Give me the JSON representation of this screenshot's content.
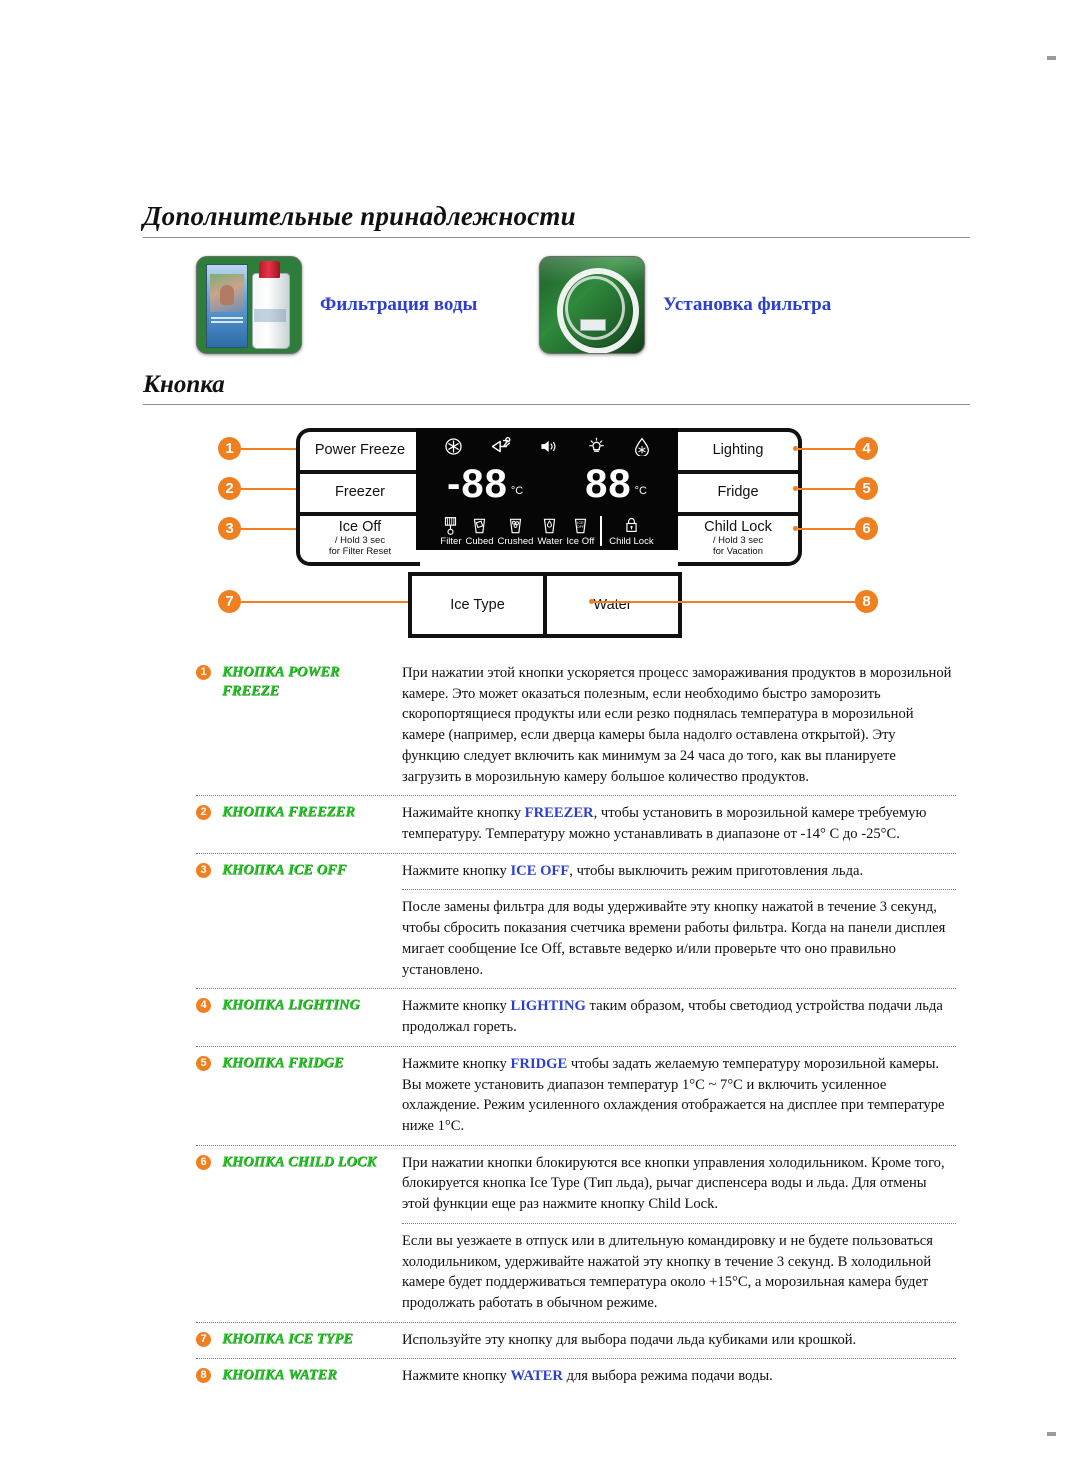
{
  "document": {
    "section_title": "Дополнительные принадлежности",
    "subsection_title": "Кнопка"
  },
  "accessories": [
    {
      "label": "Фильтрация воды",
      "image": "water-filter-box-photo"
    },
    {
      "label": "Установка фильтра",
      "image": "filter-tubing-coil-photo"
    }
  ],
  "panel": {
    "left_buttons": [
      {
        "badge": "1",
        "main": "Power Freeze",
        "sub1": "",
        "sub2": ""
      },
      {
        "badge": "2",
        "main": "Freezer",
        "sub1": "",
        "sub2": ""
      },
      {
        "badge": "3",
        "main": "Ice Off",
        "sub1": "/ Hold 3 sec",
        "sub2": "for Filter Reset"
      }
    ],
    "right_buttons": [
      {
        "badge": "4",
        "main": "Lighting",
        "sub1": "",
        "sub2": ""
      },
      {
        "badge": "5",
        "main": "Fridge",
        "sub1": "",
        "sub2": ""
      },
      {
        "badge": "6",
        "main": "Child Lock",
        "sub1": "/ Hold 3 sec",
        "sub2": "for Vacation"
      }
    ],
    "bottom_buttons": [
      {
        "badge": "7",
        "label": "Ice Type"
      },
      {
        "badge": "8",
        "label": "Water"
      }
    ],
    "lcd": {
      "top_icons": [
        "snowflake-icon",
        "power-freeze-icon",
        "speaker-icon",
        "lamp-icon",
        "water-drop-icon"
      ],
      "freezer_value": "-88",
      "freezer_unit": "°C",
      "fridge_value": "88",
      "fridge_unit": "°C",
      "indicators": [
        {
          "label": "Filter",
          "icon": "filter-icon"
        },
        {
          "label": "Cubed",
          "icon": "cubed-ice-glass-icon"
        },
        {
          "label": "Crushed",
          "icon": "crushed-ice-glass-icon"
        },
        {
          "label": "Water",
          "icon": "water-glass-icon"
        },
        {
          "label": "Ice Off",
          "icon": "ice-off-glass-icon"
        },
        {
          "label": "Child Lock",
          "icon": "padlock-icon"
        }
      ]
    }
  },
  "colors": {
    "accent_orange": "#f07f20",
    "link_blue": "#2b3fd0",
    "label_green": "#25c525",
    "lcd_background": "#060606"
  },
  "descriptions": [
    {
      "badge": "1",
      "name": "КНОПКА POWER FREEZE",
      "paragraphs": [
        {
          "segments": [
            {
              "t": "При нажатии этой кнопки ускоряется процесс замораживания продуктов в морозильной камере. Это может оказаться полезным, если необходимо быстро заморозить скоропортящиеся продукты или если резко поднялась температура в морозильной камере (например, если дверца камеры была надолго оставлена открытой). Эту функцию следует включить как минимум за 24 часа до того, как вы планируете загрузить в морозильную камеру большое количество продуктов."
            }
          ]
        }
      ]
    },
    {
      "badge": "2",
      "name": "КНОПКА FREEZER",
      "paragraphs": [
        {
          "segments": [
            {
              "t": "Нажимайте кнопку "
            },
            {
              "t": "FREEZER",
              "hl": true
            },
            {
              "t": ", чтобы установить в морозильной камере требуемую температуру. Температуру можно устанавливать в диапазоне от -14° С до -25°С."
            }
          ]
        }
      ]
    },
    {
      "badge": "3",
      "name": "КНОПКА ICE OFF",
      "paragraphs": [
        {
          "segments": [
            {
              "t": "Нажмите кнопку "
            },
            {
              "t": "ICE OFF",
              "hl": true
            },
            {
              "t": ", чтобы выключить режим приготовления льда."
            }
          ]
        },
        {
          "segments": [
            {
              "t": "После замены фильтра для воды удерживайте эту кнопку нажатой в течение 3 секунд, чтобы сбросить показания счетчика времени работы фильтра. Когда на панели дисплея мигает сообщение Ice Off, вставьте ведерко и/или проверьте что оно правильно установлено."
            }
          ]
        }
      ]
    },
    {
      "badge": "4",
      "name": "КНОПКА LIGHTING",
      "paragraphs": [
        {
          "segments": [
            {
              "t": "Нажмите кнопку "
            },
            {
              "t": "LIGHTING",
              "hl": true
            },
            {
              "t": " таким образом, чтобы светодиод устройства подачи льда продолжал гореть."
            }
          ]
        }
      ]
    },
    {
      "badge": "5",
      "name": "КНОПКА FRIDGE",
      "paragraphs": [
        {
          "segments": [
            {
              "t": "Нажмите кнопку "
            },
            {
              "t": "FRIDGE",
              "hl": true
            },
            {
              "t": " чтобы задать желаемую температуру морозильной камеры. Вы можете установить диапазон температур 1°С ~ 7°С и включить усиленное охлаждение. Режим усиленного охлаждения отображается на дисплее при температуре ниже 1°С."
            }
          ]
        }
      ]
    },
    {
      "badge": "6",
      "name": "КНОПКА CHILD LOCK",
      "paragraphs": [
        {
          "segments": [
            {
              "t": "При нажатии кнопки блокируются все кнопки управления холодильником. Кроме того, блокируется кнопка Ice Type (Тип льда), рычаг диспенсера воды и льда. Для отмены этой функции еще раз нажмите кнопку Child Lock."
            }
          ]
        },
        {
          "segments": [
            {
              "t": "Если вы уезжаете в отпуск или в длительную командировку и не будете пользоваться холодильником, удерживайте нажатой эту кнопку в течение 3 секунд. В холодильной камере будет поддерживаться температура около +15°С, а морозильная камера будет продолжать работать в обычном режиме."
            }
          ]
        }
      ]
    },
    {
      "badge": "7",
      "name": "КНОПКА ICE TYPE",
      "paragraphs": [
        {
          "segments": [
            {
              "t": "Используйте эту кнопку для выбора подачи льда кубиками или крошкой."
            }
          ]
        }
      ]
    },
    {
      "badge": "8",
      "name": "КНОПКА WATER",
      "paragraphs": [
        {
          "segments": [
            {
              "t": "Нажмите кнопку "
            },
            {
              "t": "WATER",
              "hl": true
            },
            {
              "t": " для выбора режима подачи воды."
            }
          ]
        }
      ]
    }
  ]
}
